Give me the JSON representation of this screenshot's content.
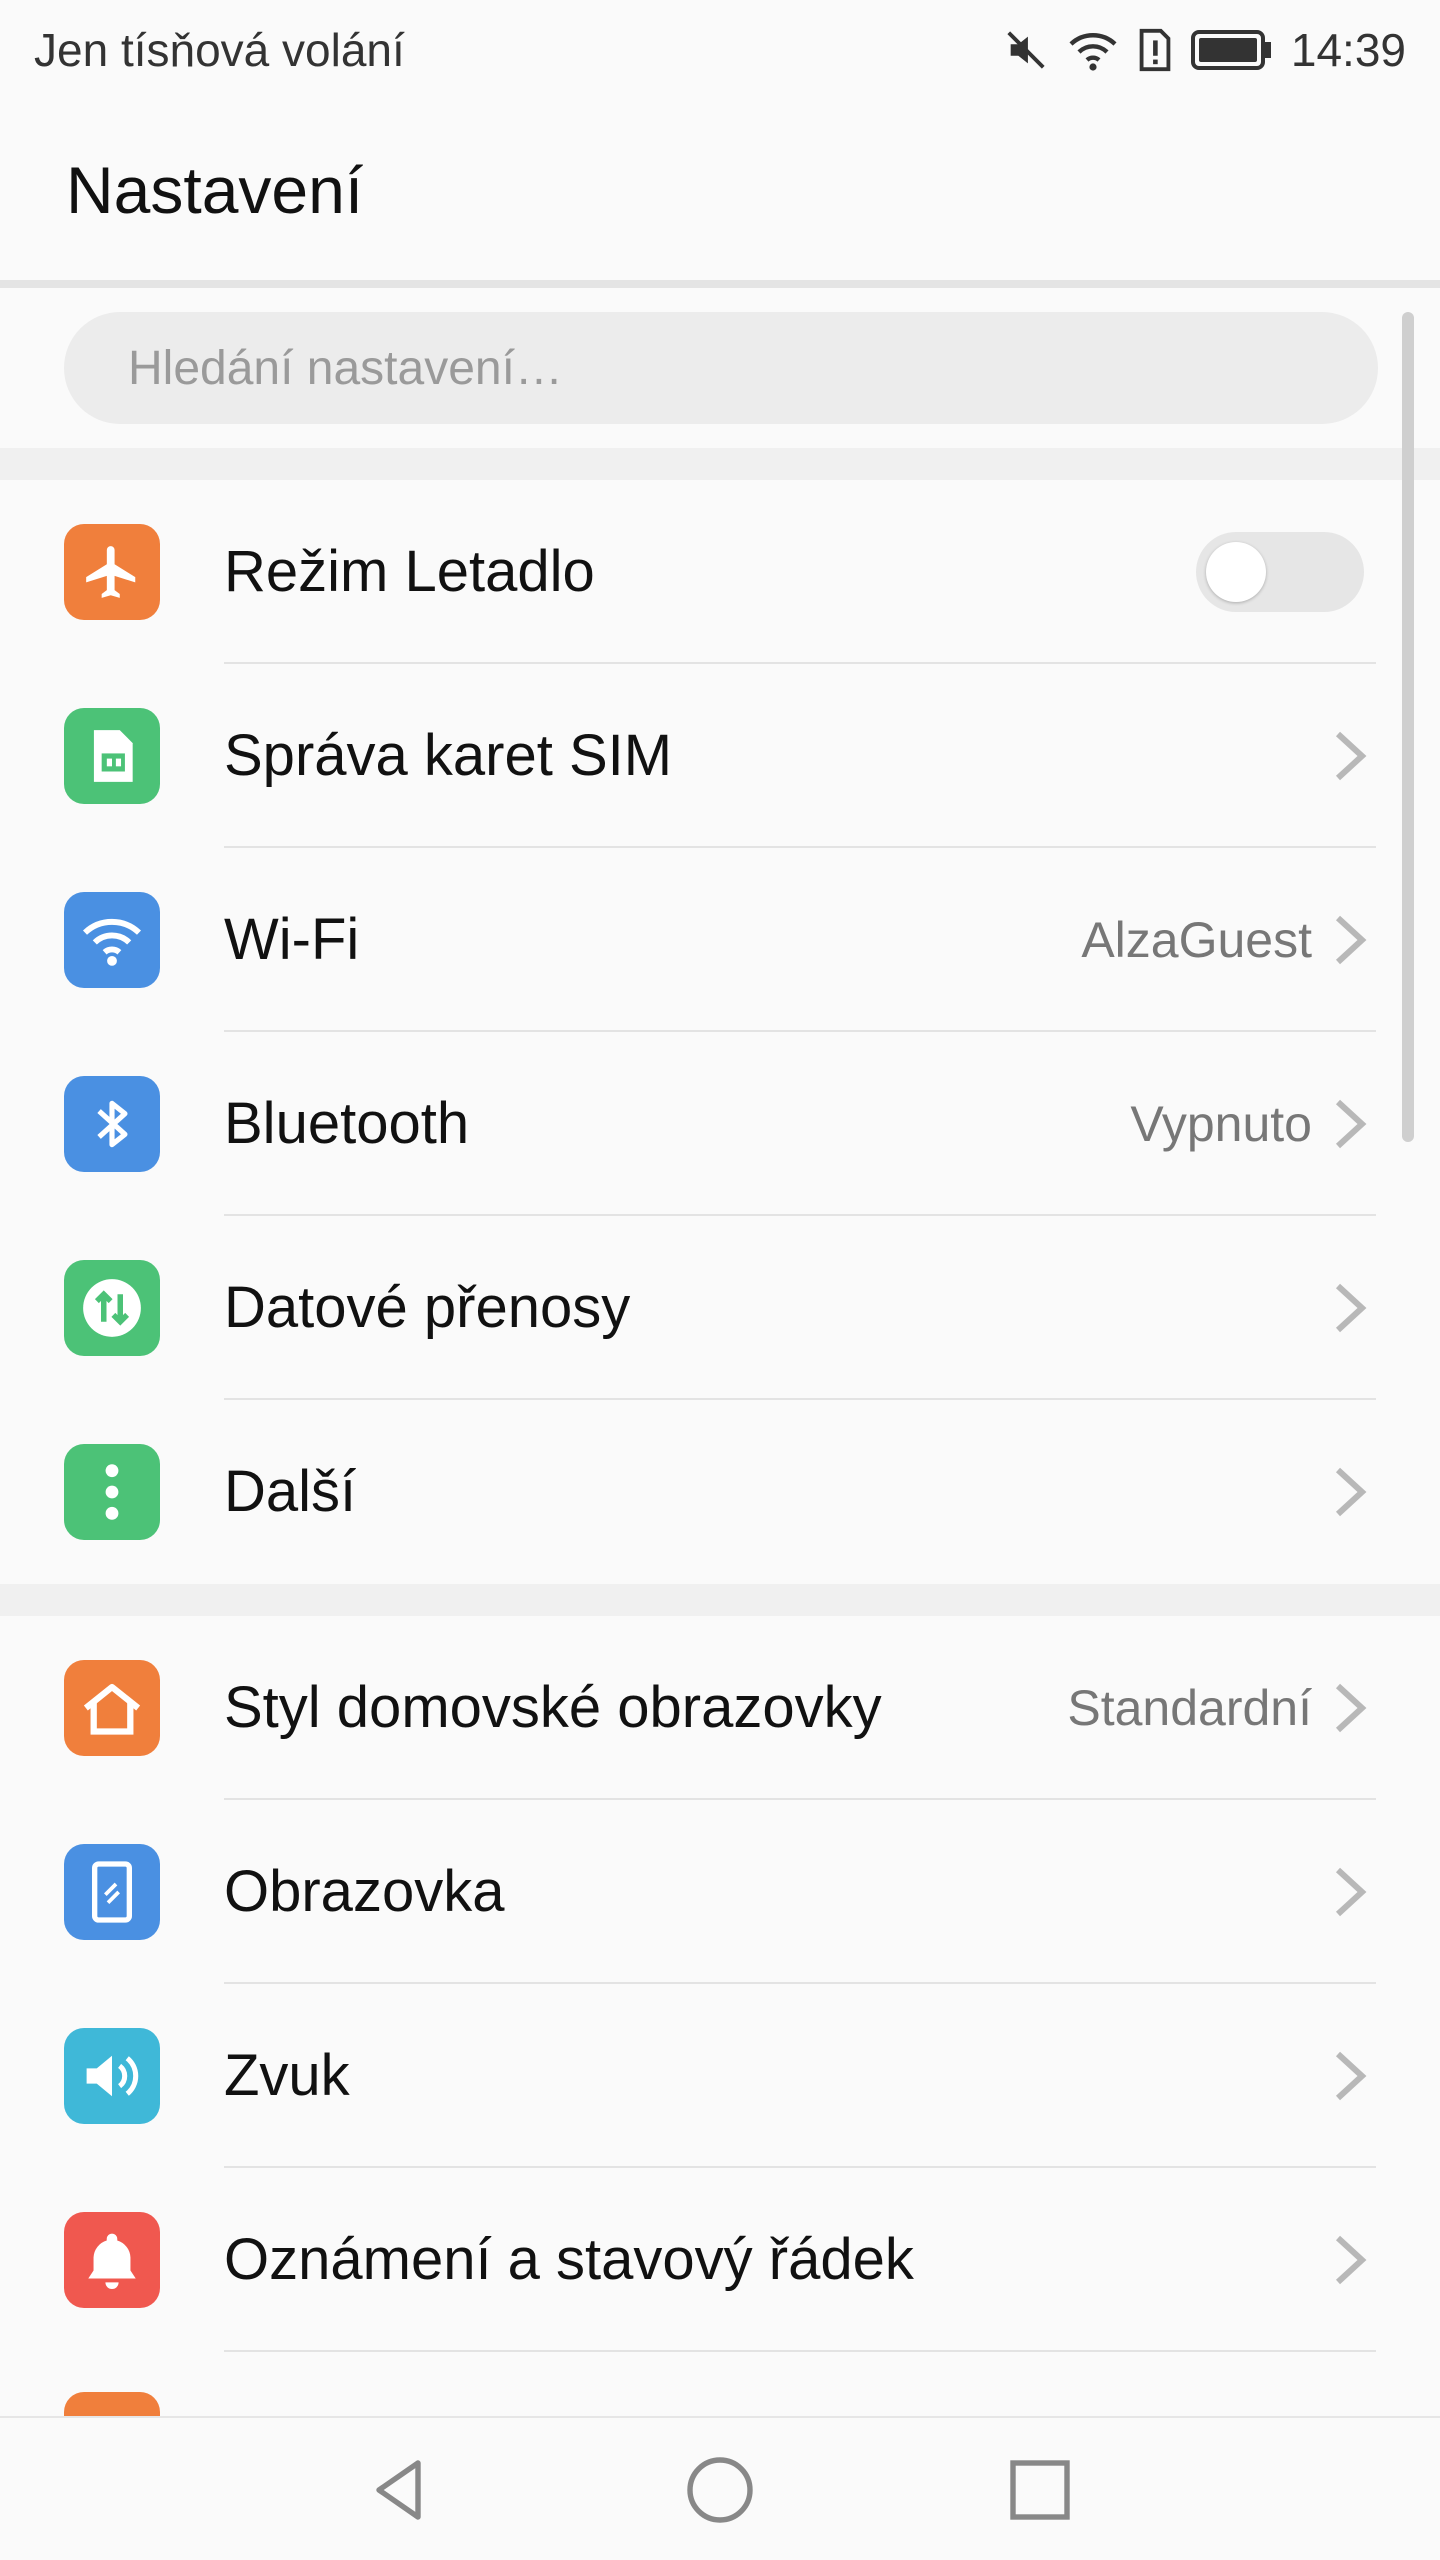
{
  "status_bar": {
    "carrier_text": "Jen tísňová volání",
    "time": "14:39",
    "icons": [
      "mute-icon",
      "wifi-icon",
      "sim-alert-icon",
      "battery-icon"
    ]
  },
  "header": {
    "title": "Nastavení"
  },
  "search": {
    "placeholder": "Hledání nastavení…"
  },
  "sections": [
    {
      "items": [
        {
          "label": "Režim Letadlo",
          "icon": "airplane-icon",
          "icon_color": "#f07f3c",
          "control": "toggle",
          "toggle_on": false
        },
        {
          "label": "Správa karet SIM",
          "icon": "sim-card-icon",
          "icon_color": "#4cc277",
          "control": "chevron"
        },
        {
          "label": "Wi-Fi",
          "icon": "wifi-icon",
          "icon_color": "#4a90e2",
          "value": "AlzaGuest",
          "control": "chevron"
        },
        {
          "label": "Bluetooth",
          "icon": "bluetooth-icon",
          "icon_color": "#4a90e2",
          "value": "Vypnuto",
          "control": "chevron"
        },
        {
          "label": "Datové přenosy",
          "icon": "data-transfer-icon",
          "icon_color": "#4cc277",
          "control": "chevron"
        },
        {
          "label": "Další",
          "icon": "more-icon",
          "icon_color": "#4cc277",
          "control": "chevron"
        }
      ]
    },
    {
      "items": [
        {
          "label": "Styl domovské obrazovky",
          "icon": "home-icon",
          "icon_color": "#f07f3c",
          "value": "Standardní",
          "control": "chevron"
        },
        {
          "label": "Obrazovka",
          "icon": "display-icon",
          "icon_color": "#4a90e2",
          "control": "chevron"
        },
        {
          "label": "Zvuk",
          "icon": "sound-icon",
          "icon_color": "#3fb8d8",
          "control": "chevron"
        },
        {
          "label": "Oznámení a stavový řádek",
          "icon": "bell-icon",
          "icon_color": "#f0584f",
          "control": "chevron"
        }
      ]
    }
  ],
  "nav_bar": {
    "buttons": [
      "back-icon",
      "home-circle-icon",
      "recents-icon"
    ]
  }
}
